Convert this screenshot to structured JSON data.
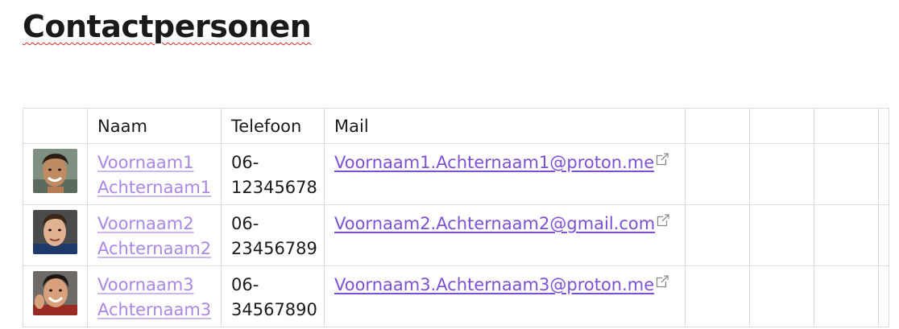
{
  "page": {
    "title": "Contactpersonen"
  },
  "table": {
    "headers": {
      "photo": "",
      "naam": "Naam",
      "telefoon": "Telefoon",
      "mail": "Mail"
    },
    "rows": [
      {
        "first_name": "Voornaam1",
        "last_name": "Achternaam1",
        "tel_prefix": "06-",
        "tel_number": "12345678",
        "mail": "Voornaam1.Achternaam1@proton.me",
        "avatar_icon": "avatar-photo"
      },
      {
        "first_name": "Voornaam2",
        "last_name": "Achternaam2",
        "tel_prefix": "06-",
        "tel_number": "23456789",
        "mail": "Voornaam2.Achternaam2@gmail.com",
        "avatar_icon": "avatar-photo"
      },
      {
        "first_name": "Voornaam3",
        "last_name": "Achternaam3",
        "tel_prefix": "06-",
        "tel_number": "34567890",
        "mail": "Voornaam3.Achternaam3@proton.me",
        "avatar_icon": "avatar-photo"
      }
    ]
  },
  "colors": {
    "name_link": "#a987e4",
    "mail_link": "#7b4fd6",
    "grid_border": "#dcdcdc",
    "spellcheck_underline": "#d62a2a"
  }
}
